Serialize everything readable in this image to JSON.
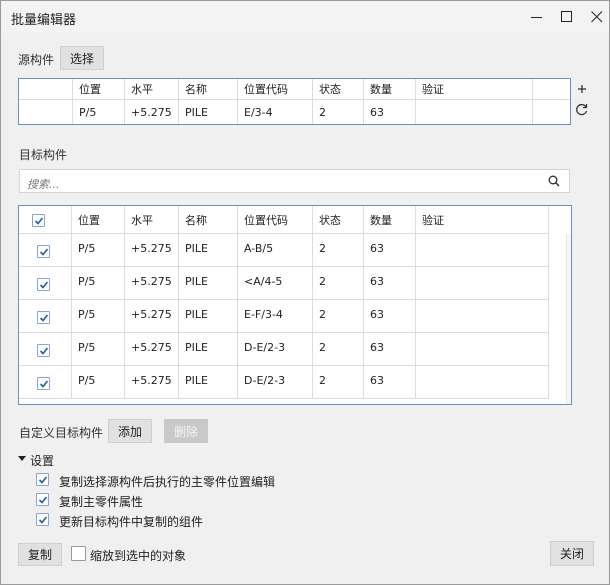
{
  "window": {
    "title": "批量编辑器"
  },
  "source": {
    "label": "源构件",
    "select_button": "选择",
    "columns": [
      "位置",
      "水平",
      "名称",
      "位置代码",
      "状态",
      "数量",
      "验证"
    ],
    "row": {
      "pos": "P/5",
      "level": "+5.275",
      "name": "PILE",
      "code": "E/3-4",
      "status": "2",
      "qty": "63",
      "verify": ""
    }
  },
  "target": {
    "label": "目标构件",
    "search": {
      "placeholder": "搜索..."
    },
    "columns": [
      "位置",
      "水平",
      "名称",
      "位置代码",
      "状态",
      "数量",
      "验证"
    ],
    "rows": [
      {
        "checked": true,
        "pos": "P/5",
        "level": "+5.275",
        "name": "PILE",
        "code": "A-B/5",
        "status": "2",
        "qty": "63",
        "verify": ""
      },
      {
        "checked": true,
        "pos": "P/5",
        "level": "+5.275",
        "name": "PILE",
        "code": "<A/4-5",
        "status": "2",
        "qty": "63",
        "verify": ""
      },
      {
        "checked": true,
        "pos": "P/5",
        "level": "+5.275",
        "name": "PILE",
        "code": "E-F/3-4",
        "status": "2",
        "qty": "63",
        "verify": ""
      },
      {
        "checked": true,
        "pos": "P/5",
        "level": "+5.275",
        "name": "PILE",
        "code": "D-E/2-3",
        "status": "2",
        "qty": "63",
        "verify": ""
      },
      {
        "checked": true,
        "pos": "P/5",
        "level": "+5.275",
        "name": "PILE",
        "code": "D-E/2-3",
        "status": "2",
        "qty": "63",
        "verify": ""
      }
    ]
  },
  "custom": {
    "label": "自定义目标构件",
    "add_button": "添加",
    "delete_button": "删除"
  },
  "settings": {
    "header": "设置",
    "options": [
      {
        "label": "复制选择源构件后执行的主零件位置编辑",
        "checked": true
      },
      {
        "label": "复制主零件属性",
        "checked": true
      },
      {
        "label": "更新目标构件中复制的组件",
        "checked": true
      }
    ]
  },
  "footer": {
    "copy_button": "复制",
    "zoom_label": "缩放到选中的对象",
    "zoom_checked": false,
    "close_button": "关闭"
  },
  "colors": {
    "accent": "#1f5fa8",
    "grid_border": "#6d8fc0"
  }
}
